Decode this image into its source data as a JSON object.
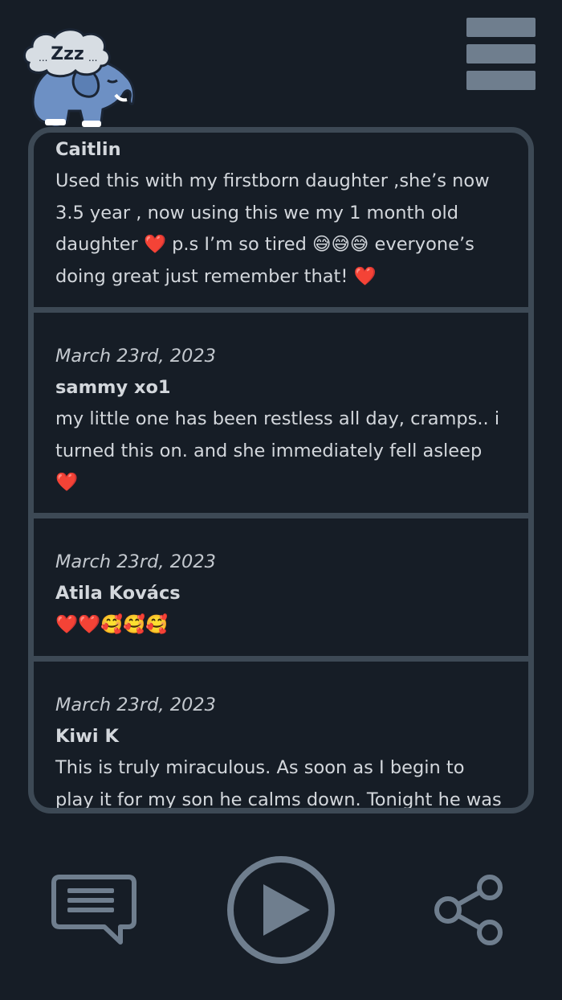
{
  "app": {
    "logo_icon": "sleeping-elephant-icon",
    "logo_text": "...Zzz..."
  },
  "header": {
    "menu_icon": "hamburger-menu-icon"
  },
  "reviews": [
    {
      "author": "Caitlin",
      "text": "Used this with my firstborn daughter ,she’s now 3.5 year , now using this we my 1 month old daughter ❤️ p.s I’m so tired 😅😅😅 everyone’s doing great just remember that! ❤️"
    },
    {
      "date": "March 23rd, 2023",
      "author": "sammy xo1",
      "text": "my little one has been restless all day, cramps.. i turned this on. and she immediately fell asleep ❤️"
    },
    {
      "date": "March 23rd, 2023",
      "author": "Atila Kovács",
      "text": "❤️❤️🥰🥰🥰"
    },
    {
      "date": "March 23rd, 2023",
      "author": "Kiwi K",
      "text": "This is truly miraculous. As soon as I begin to play it for my son he calms down. Tonight he was"
    }
  ],
  "footer": {
    "comment_icon": "comment-icon",
    "play_icon": "play-icon",
    "share_icon": "share-icon"
  },
  "colors": {
    "background": "#161d26",
    "panel_border": "#3d4955",
    "icon_gray": "#6f7e8e",
    "text": "#d3d7dc"
  }
}
